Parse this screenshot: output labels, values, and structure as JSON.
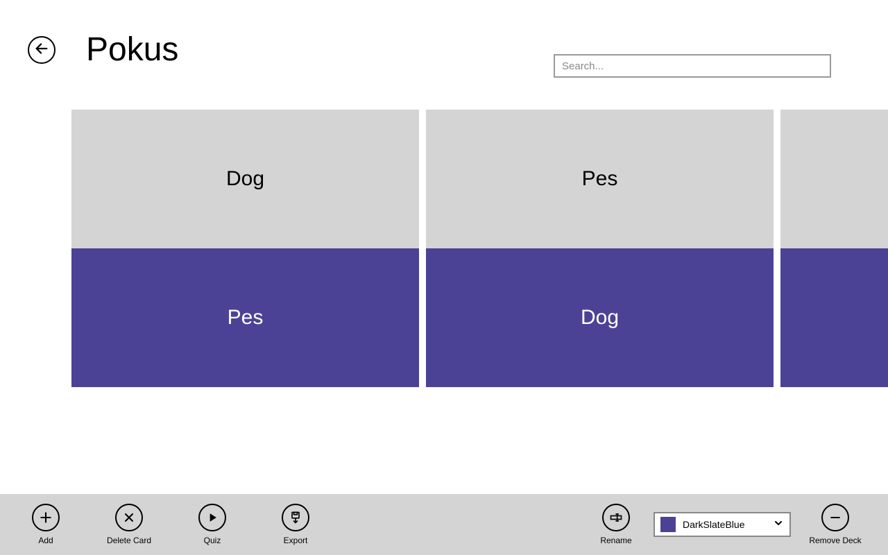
{
  "header": {
    "title": "Pokus",
    "search_placeholder": "Search..."
  },
  "cards": [
    {
      "front": "Dog",
      "back": "Pes"
    },
    {
      "front": "Pes",
      "back": "Dog"
    },
    {
      "front": "",
      "back": ""
    }
  ],
  "colors": {
    "card_front_bg": "#d4d4d4",
    "card_back_bg": "#4c4295"
  },
  "appbar": {
    "add": "Add",
    "delete": "Delete Card",
    "quiz": "Quiz",
    "export": "Export",
    "rename": "Rename",
    "remove_deck": "Remove Deck",
    "color_selected": "DarkSlateBlue"
  }
}
